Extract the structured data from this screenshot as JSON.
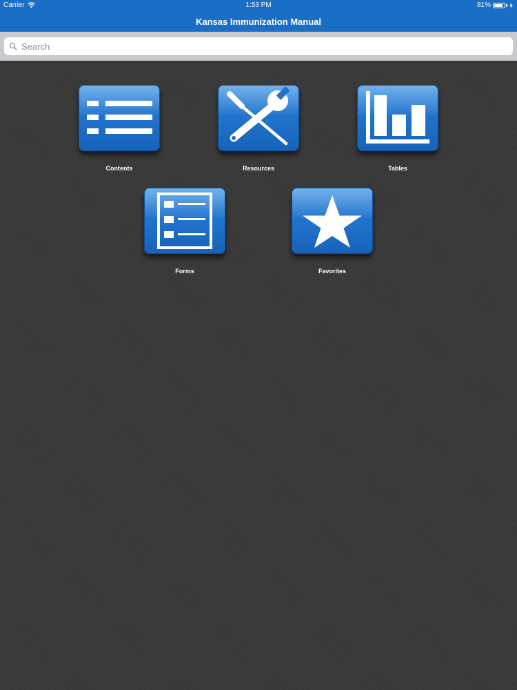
{
  "status_bar": {
    "carrier": "Carrier",
    "time": "1:53 PM",
    "battery": "81%"
  },
  "nav": {
    "title": "Kansas Immunization Manual"
  },
  "search": {
    "placeholder": "Search"
  },
  "tiles": [
    {
      "label": "Contents",
      "icon": "list-icon"
    },
    {
      "label": "Resources",
      "icon": "tools-icon"
    },
    {
      "label": "Tables",
      "icon": "bar-chart-icon"
    },
    {
      "label": "Forms",
      "icon": "form-checklist-icon"
    },
    {
      "label": "Favorites",
      "icon": "star-icon"
    }
  ]
}
